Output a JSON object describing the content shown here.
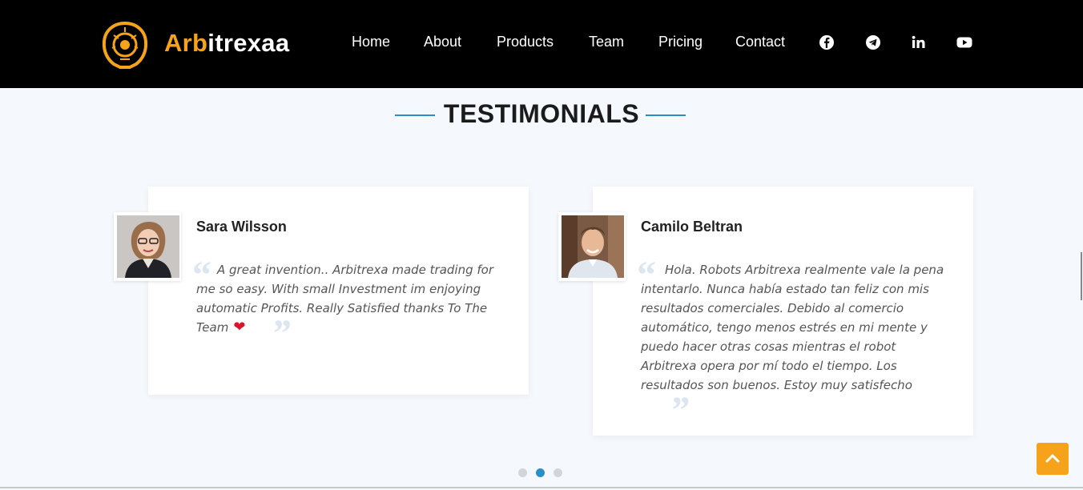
{
  "brand": {
    "part1": "Arb",
    "part2": "itrexaa",
    "accent_color": "#f7a21b"
  },
  "nav": {
    "items": [
      "Home",
      "About",
      "Products",
      "Team",
      "Pricing",
      "Contact"
    ],
    "social_icons": [
      "facebook-icon",
      "telegram-icon",
      "linkedin-icon",
      "youtube-icon"
    ]
  },
  "section": {
    "title": "TESTIMONIALS",
    "line_color": "#2b8fc7"
  },
  "testimonials": [
    {
      "name": "Sara Wilsson",
      "text": "A great invention.. Arbitrexa made trading for me so easy. With small Investment im enjoying automatic Profits. Really Satisfied thanks To The Team",
      "emoji": "❤"
    },
    {
      "name": "Camilo Beltran",
      "text": "Hola. Robots Arbitrexa realmente vale la pena intentarlo. Nunca había estado tan feliz con mis resultados comerciales. Debido al comercio automático, tengo menos estrés en mi mente y puedo hacer otras cosas mientras el robot Arbitrexa opera por mí todo el tiempo. Los resultados son buenos. Estoy muy satisfecho"
    }
  ],
  "carousel": {
    "page_count": 3,
    "active_page": 2
  },
  "back_to_top_icon": "chevron-up-icon"
}
